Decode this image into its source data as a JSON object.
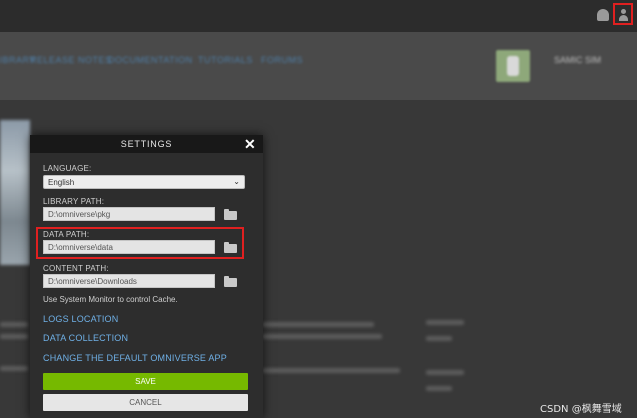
{
  "topbar": {
    "icons": [
      "bell-icon",
      "user-icon"
    ],
    "highlight_color": "#e02020"
  },
  "navbar": {
    "items": [
      "LIBRARY",
      "RELEASE NOTES",
      "DOCUMENTATION",
      "TUTORIALS",
      "FORUMS"
    ],
    "user_label": "SAMIC SIM"
  },
  "settings": {
    "title": "SETTINGS",
    "language_label": "LANGUAGE:",
    "language_value": "English",
    "library_path_label": "LIBRARY PATH:",
    "library_path_value": "D:\\omniverse\\pkg",
    "data_path_label": "DATA PATH:",
    "data_path_value": "D:\\omniverse\\data",
    "content_path_label": "CONTENT PATH:",
    "content_path_value": "D:\\omniverse\\Downloads",
    "cache_info": "Use System Monitor to control Cache.",
    "links": {
      "logs": "LOGS LOCATION",
      "data_collection": "DATA COLLECTION",
      "change_default_app": "CHANGE THE DEFAULT OMNIVERSE APP"
    },
    "save_label": "SAVE",
    "cancel_label": "CANCEL",
    "colors": {
      "save": "#76b900",
      "link": "#6fb0e6",
      "highlight": "#e02020"
    }
  },
  "watermark": "CSDN @枫舞雪域"
}
